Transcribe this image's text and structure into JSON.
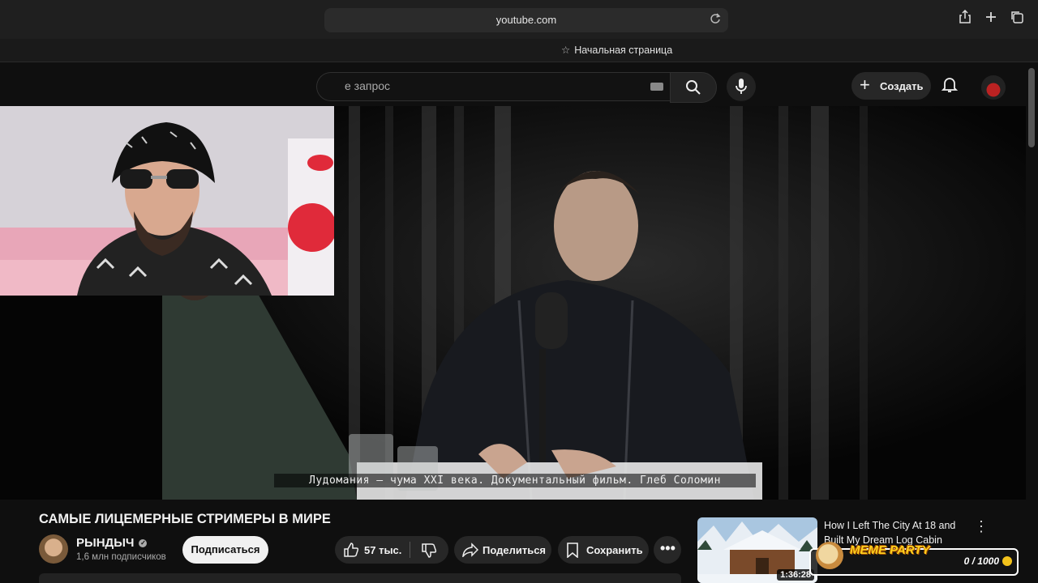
{
  "browser": {
    "url": "youtube.com",
    "favorites_item": "Начальная страница"
  },
  "youtube": {
    "search_placeholder": "е запрос",
    "create_label": "Создать"
  },
  "video": {
    "subtitle": "Лудомания – чума XXI века. Документальный фильм. Глеб Соломин",
    "title": "САМЫЕ ЛИЦЕМЕРНЫЕ СТРИМЕРЫ В МИРЕ"
  },
  "channel": {
    "name": "РЫНДЫЧ",
    "subscribers": "1,6 млн подписчиков",
    "subscribe_label": "Подписаться"
  },
  "actions": {
    "likes": "57 тыс.",
    "share_label": "Поделиться",
    "save_label": "Сохранить"
  },
  "recommended": {
    "title": "How I Left The City At 18 and Built My Dream Log Cabin",
    "duration": "1:36:28"
  },
  "overlay": {
    "meme_title": "MEME PARTY",
    "meme_counter": "0 / 1000"
  },
  "icons": [
    "reload-icon",
    "share-icon",
    "new-tab-icon",
    "tabs-icon",
    "star-icon",
    "keyboard-icon",
    "search-icon",
    "mic-icon",
    "plus-icon",
    "bell-icon",
    "verified-icon",
    "like-icon",
    "dislike-icon",
    "share-arrow-icon",
    "bookmark-icon",
    "more-icon",
    "kebab-icon",
    "coin-icon"
  ]
}
